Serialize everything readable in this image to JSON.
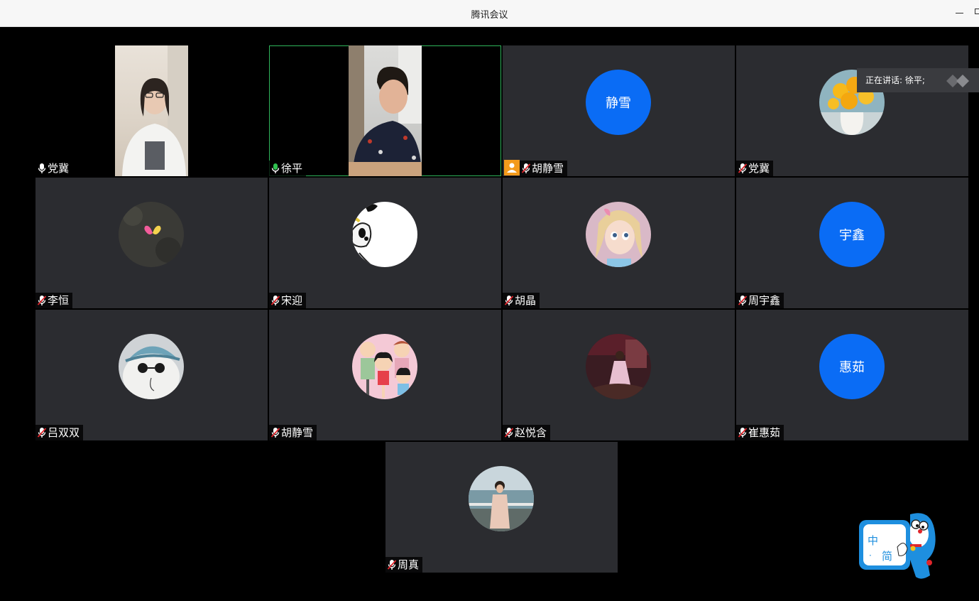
{
  "window": {
    "title": "腾讯会议"
  },
  "speaking": {
    "label": "正在讲话: 徐平;"
  },
  "participants": [
    {
      "name": "党冀",
      "view": "video",
      "mic": "on"
    },
    {
      "name": "徐平",
      "view": "video",
      "mic": "active",
      "active_speaker": true
    },
    {
      "name": "胡静雪",
      "view": "text-avatar",
      "avatar_text": "静雪",
      "mic": "muted",
      "host": true
    },
    {
      "name": "党冀",
      "view": "photo-avatar",
      "avatar": "sunflower-vase",
      "mic": "muted"
    },
    {
      "name": "李恒",
      "view": "photo-avatar",
      "avatar": "pink-heart-dark",
      "mic": "muted"
    },
    {
      "name": "宋迎",
      "view": "photo-avatar",
      "avatar": "cartoon-dog",
      "mic": "muted"
    },
    {
      "name": "胡晶",
      "view": "photo-avatar",
      "avatar": "cartoon-girl",
      "mic": "muted"
    },
    {
      "name": "周宇鑫",
      "view": "text-avatar",
      "avatar_text": "宇鑫",
      "mic": "muted"
    },
    {
      "name": "吕双双",
      "view": "photo-avatar",
      "avatar": "cat-with-cap",
      "mic": "muted"
    },
    {
      "name": "胡静雪",
      "view": "photo-avatar",
      "avatar": "cartoon-family",
      "mic": "muted"
    },
    {
      "name": "赵悦含",
      "view": "photo-avatar",
      "avatar": "girl-dark-room",
      "mic": "muted"
    },
    {
      "name": "崔惠茹",
      "view": "text-avatar",
      "avatar_text": "惠茹",
      "mic": "muted"
    },
    {
      "name": "周真",
      "view": "photo-avatar",
      "avatar": "woman-by-sea",
      "mic": "muted"
    }
  ],
  "ime": {
    "mode": "中",
    "script": "简",
    "dot": "·"
  },
  "colors": {
    "avatar_blue": "#0a6cf5",
    "active_border": "#2fb55b",
    "host_orange": "#f39a1b",
    "tile_bg": "#2b2c30"
  }
}
